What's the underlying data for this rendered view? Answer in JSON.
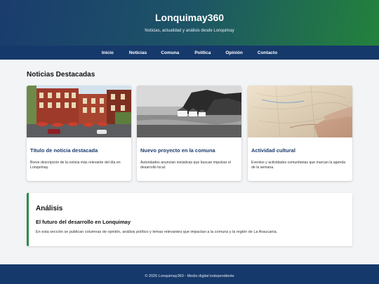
{
  "site": {
    "title": "Lonquimay360",
    "tagline": "Noticias, actualidad y análisis desde Lonquimay"
  },
  "nav": {
    "items": [
      "Inicio",
      "Noticias",
      "Comuna",
      "Política",
      "Opinión",
      "Contacto"
    ]
  },
  "featured": {
    "heading": "Noticias Destacadas",
    "cards": [
      {
        "image": "town-street-photo",
        "title": "Título de noticia destacada",
        "description": "Breve descripción de la noticia más relevante del día en Lonquimay."
      },
      {
        "image": "coastal-village-photo",
        "title": "Nuevo proyecto en la comuna",
        "description": "Autoridades anuncian iniciativas que buscan impulsar el desarrollo local."
      },
      {
        "image": "map-in-hands-photo",
        "title": "Actividad cultural",
        "description": "Eventos y actividades comunitarias que marcan la agenda de la semana."
      }
    ]
  },
  "analysis": {
    "heading": "Análisis",
    "subtitle": "El futuro del desarrollo en Lonquimay",
    "text": "En esta sección se publican columnas de opinión, análisis político y temas relevantes que impactan a la comuna y la región de La Araucanía."
  },
  "footer": {
    "text": "© 2026 Lonquimay360 - Medio digital independiente"
  },
  "colors": {
    "header_start": "#1a3c6e",
    "header_end": "#23823c",
    "nav_bg": "#16396b",
    "accent_green": "#2e8b46",
    "card_title": "#1a3c6e"
  }
}
